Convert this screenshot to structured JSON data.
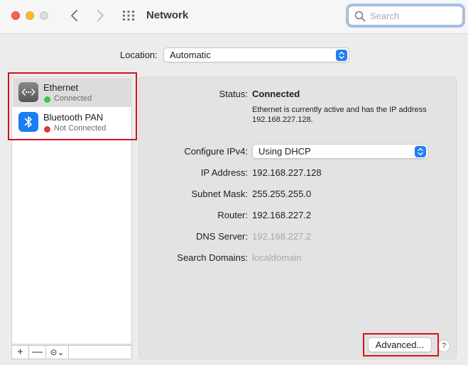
{
  "window": {
    "title": "Network"
  },
  "search": {
    "placeholder": "Search"
  },
  "location": {
    "label": "Location:",
    "value": "Automatic"
  },
  "services": [
    {
      "name": "Ethernet",
      "status": "Connected",
      "status_color": "#30c94a",
      "icon": "ethernet-icon",
      "selected": true
    },
    {
      "name": "Bluetooth PAN",
      "status": "Not Connected",
      "status_color": "#e8323a",
      "icon": "bluetooth-icon",
      "selected": false
    }
  ],
  "sidebar_controls": {
    "add": "+",
    "remove": "—",
    "action": "⊝⌄"
  },
  "detail": {
    "status_label": "Status:",
    "status_value": "Connected",
    "status_description": "Ethernet is currently active and has the IP address 192.168.227.128.",
    "configure_label": "Configure IPv4:",
    "configure_value": "Using DHCP",
    "ip_label": "IP Address:",
    "ip_value": "192.168.227.128",
    "subnet_label": "Subnet Mask:",
    "subnet_value": "255.255.255.0",
    "router_label": "Router:",
    "router_value": "192.168.227.2",
    "dns_label": "DNS Server:",
    "dns_value": "192.168.227.2",
    "search_domains_label": "Search Domains:",
    "search_domains_value": "localdomain"
  },
  "buttons": {
    "advanced": "Advanced...",
    "help": "?"
  },
  "colors": {
    "accent": "#1f7ff5",
    "highlight": "#d1141b"
  }
}
